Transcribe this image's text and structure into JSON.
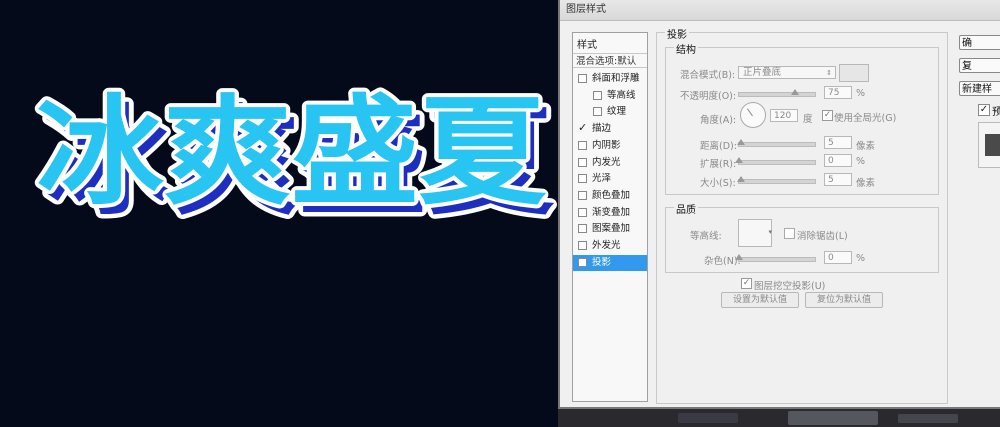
{
  "canvas": {
    "title_text": "冰爽盛夏",
    "colors": {
      "background": "#050a1a",
      "text_fill": "#29c5f2",
      "text_stroke": "#ffffff",
      "extrude": "#1e2fbf"
    }
  },
  "dialog": {
    "title": "图层样式",
    "styles_header": "样式",
    "blending_default": "混合选项:默认",
    "style_items": [
      {
        "label": "斜面和浮雕",
        "checked": false,
        "indent": false
      },
      {
        "label": "等高线",
        "checked": false,
        "indent": true
      },
      {
        "label": "纹理",
        "checked": false,
        "indent": true
      },
      {
        "label": "描边",
        "checked": true,
        "indent": false
      },
      {
        "label": "内阴影",
        "checked": false,
        "indent": false
      },
      {
        "label": "内发光",
        "checked": false,
        "indent": false
      },
      {
        "label": "光泽",
        "checked": false,
        "indent": false
      },
      {
        "label": "颜色叠加",
        "checked": false,
        "indent": false
      },
      {
        "label": "渐变叠加",
        "checked": false,
        "indent": false
      },
      {
        "label": "图案叠加",
        "checked": false,
        "indent": false
      },
      {
        "label": "外发光",
        "checked": false,
        "indent": false
      },
      {
        "label": "投影",
        "checked": false,
        "indent": false,
        "selected": true
      }
    ],
    "section_title": "投影",
    "structure": {
      "title": "结构",
      "blend_mode_label": "混合模式(B):",
      "blend_mode_value": "正片叠底",
      "opacity_label": "不透明度(O):",
      "opacity_value": "75",
      "opacity_unit": "%",
      "opacity_fraction": 0.75,
      "angle_label": "角度(A):",
      "angle_value": "120",
      "angle_unit": "度",
      "global_light_label": "使用全局光(G)",
      "global_light_checked": true,
      "distance_label": "距离(D):",
      "distance_value": "5",
      "distance_unit": "像素",
      "spread_label": "扩展(R):",
      "spread_value": "0",
      "spread_unit": "%",
      "size_label": "大小(S):",
      "size_value": "5",
      "size_unit": "像素"
    },
    "quality": {
      "title": "品质",
      "contour_label": "等高线:",
      "antialias_label": "消除锯齿(L)",
      "noise_label": "杂色(N):",
      "noise_value": "0",
      "noise_unit": "%"
    },
    "knockout_label": "图层挖空投影(U)",
    "knockout_checked": true,
    "set_default_label": "设置为默认值",
    "reset_default_label": "复位为默认值",
    "right_buttons": {
      "ok": "确",
      "reset": "复",
      "new_style": "新建样",
      "preview_label": "预",
      "preview_checked": true
    }
  }
}
